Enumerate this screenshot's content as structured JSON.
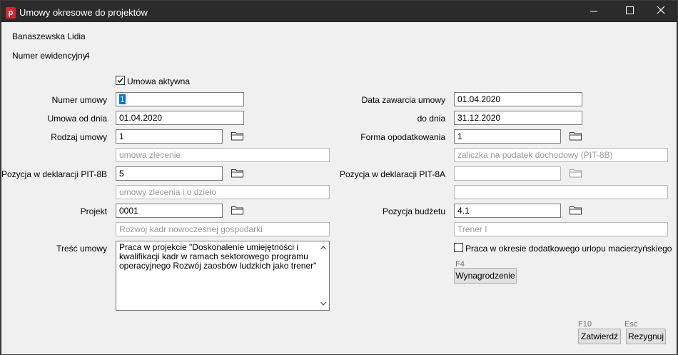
{
  "window": {
    "title": "Umowy okresowe do projektów",
    "app_icon_letter": "p"
  },
  "employee": {
    "name": "Banaszewska Lidia",
    "id_label": "Numer ewidencyjny",
    "id_value": "4"
  },
  "active": {
    "label": "Umowa aktywna",
    "checked": true
  },
  "left": {
    "contract_number": {
      "label": "Numer umowy",
      "value": "1"
    },
    "date_from": {
      "label": "Umowa od dnia",
      "value": "01.04.2020"
    },
    "contract_type": {
      "label": "Rodzaj umowy",
      "value": "1",
      "description": "umowa zlecenie"
    },
    "pit8b": {
      "label": "Pozycja w deklaracji PIT-8B",
      "value": "5",
      "description": "umowy zlecenia i o dzieło"
    },
    "project": {
      "label": "Projekt",
      "value": "0001",
      "description": "Rozwój kadr nowoczesnej gospodarki"
    },
    "content": {
      "label": "Treść umowy",
      "lines": [
        "Praca w projekcie \"Doskonalenie umiejętności i",
        "kwalifikacji kadr w ramach sektorowego programu",
        "operacyjnego Rozwój zaosbów ludzkich jako trener\""
      ]
    }
  },
  "right": {
    "date_signed": {
      "label": "Data zawarcia umowy",
      "value": "01.04.2020"
    },
    "date_to": {
      "label": "do dnia",
      "value": "31.12.2020"
    },
    "tax_form": {
      "label": "Forma opodatkowania",
      "value": "1",
      "description": "zaliczka na podatek dochodowy (PIT-8B)"
    },
    "pit8a": {
      "label": "Pozycja w deklaracji PIT-8A",
      "value": "",
      "description": ""
    },
    "budget": {
      "label": "Pozycja budżetu",
      "value": "4.1",
      "description": "Trener I"
    },
    "maternity": {
      "label": "Praca w okresie dodatkowego urlopu macierzyńskiego",
      "checked": false
    },
    "salary": {
      "fkey": "F4",
      "label": "Wynagrodzenie"
    }
  },
  "footer": {
    "confirm": {
      "fkey": "F10",
      "label": "Zatwierdź"
    },
    "cancel": {
      "fkey": "Esc",
      "label": "Rezygnuj"
    }
  },
  "colors": {
    "selection": "#0078d7",
    "app_icon": "#d9232f",
    "titlebar": "#2b2b2b",
    "client": "#f0f0f0"
  }
}
